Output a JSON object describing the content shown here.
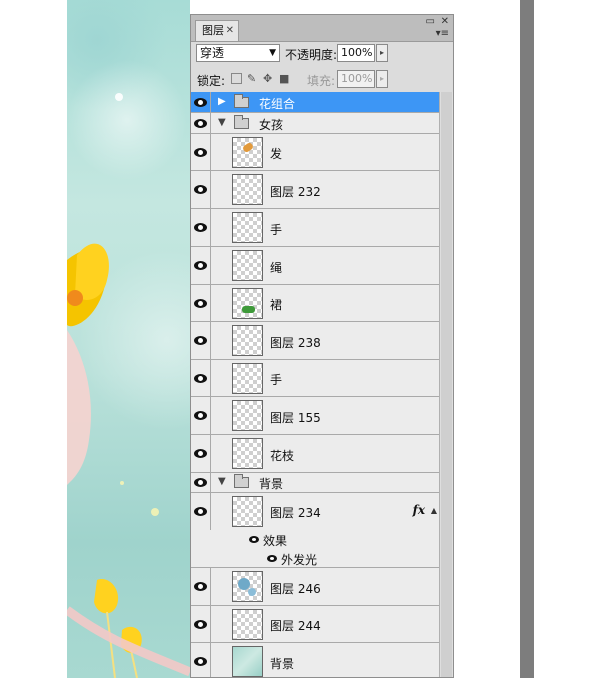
{
  "panel": {
    "tab_label": "图层",
    "tab_close": "✕",
    "minimize_glyph": "▭",
    "close_glyph": "✕",
    "menu_glyph": "▾≡"
  },
  "controls": {
    "blend_mode": "穿透",
    "opacity_label": "不透明度:",
    "opacity_value": "100%",
    "lock_label": "锁定:",
    "fill_label": "填充:",
    "fill_value": "100%"
  },
  "layers": [
    {
      "name": "花组合",
      "type": "group",
      "expanded": false,
      "selected": true
    },
    {
      "name": "女孩",
      "type": "group",
      "expanded": true
    },
    {
      "name": "发",
      "type": "layer"
    },
    {
      "name": "图层 232",
      "type": "layer"
    },
    {
      "name": "手",
      "type": "layer"
    },
    {
      "name": "绳",
      "type": "layer"
    },
    {
      "name": "裙",
      "type": "layer"
    },
    {
      "name": "图层 238",
      "type": "layer"
    },
    {
      "name": "手",
      "type": "layer"
    },
    {
      "name": "图层 155",
      "type": "layer"
    },
    {
      "name": "花枝",
      "type": "layer"
    },
    {
      "name": "背景",
      "type": "group",
      "expanded": true
    },
    {
      "name": "图层 234",
      "type": "layer",
      "fx": "fx"
    },
    {
      "name": "效果",
      "type": "effect-group"
    },
    {
      "name": "外发光",
      "type": "effect"
    },
    {
      "name": "图层 246",
      "type": "layer"
    },
    {
      "name": "图层 244",
      "type": "layer"
    },
    {
      "name": "背景",
      "type": "layer"
    }
  ],
  "icons": {
    "eye": "eye-icon",
    "folder": "folder-icon",
    "expand": "triangle-icon",
    "fx": "fx-icon"
  },
  "colors": {
    "selection": "#3d96f5",
    "panel_bg": "#d4d4d4"
  }
}
